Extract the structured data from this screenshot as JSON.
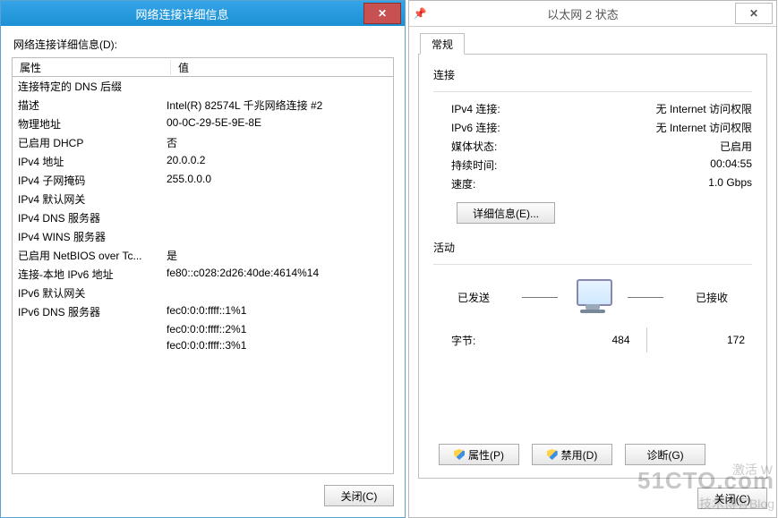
{
  "left": {
    "title": "网络连接详细信息",
    "listLabel": "网络连接详细信息(D):",
    "header": {
      "col1": "属性",
      "col2": "值"
    },
    "rows": [
      {
        "p": "连接特定的 DNS 后缀",
        "v": ""
      },
      {
        "p": "描述",
        "v": "Intel(R) 82574L 千兆网络连接 #2"
      },
      {
        "p": "物理地址",
        "v": "00-0C-29-5E-9E-8E"
      },
      {
        "p": "已启用 DHCP",
        "v": "否"
      },
      {
        "p": "IPv4 地址",
        "v": "20.0.0.2"
      },
      {
        "p": "IPv4 子网掩码",
        "v": "255.0.0.0"
      },
      {
        "p": "IPv4 默认网关",
        "v": ""
      },
      {
        "p": "IPv4 DNS 服务器",
        "v": ""
      },
      {
        "p": "IPv4 WINS 服务器",
        "v": ""
      },
      {
        "p": "已启用 NetBIOS over Tc...",
        "v": "是"
      },
      {
        "p": "连接-本地 IPv6 地址",
        "v": "fe80::c028:2d26:40de:4614%14"
      },
      {
        "p": "IPv6 默认网关",
        "v": ""
      },
      {
        "p": "IPv6 DNS 服务器",
        "v": "fec0:0:0:ffff::1%1"
      },
      {
        "p": "",
        "v": "fec0:0:0:ffff::2%1"
      },
      {
        "p": "",
        "v": "fec0:0:0:ffff::3%1"
      }
    ],
    "closeBtn": "关闭(C)"
  },
  "right": {
    "title": "以太网 2 状态",
    "tab": "常规",
    "conn": {
      "title": "连接",
      "rows": [
        {
          "k": "IPv4 连接:",
          "v": "无 Internet 访问权限"
        },
        {
          "k": "IPv6 连接:",
          "v": "无 Internet 访问权限"
        },
        {
          "k": "媒体状态:",
          "v": "已启用"
        },
        {
          "k": "持续时间:",
          "v": "00:04:55"
        },
        {
          "k": "速度:",
          "v": "1.0 Gbps"
        }
      ],
      "detailsBtn": "详细信息(E)..."
    },
    "activity": {
      "title": "活动",
      "sent": "已发送",
      "recv": "已接收",
      "bytesLabel": "字节:",
      "sentBytes": "484",
      "recvBytes": "172"
    },
    "buttons": {
      "props": "属性(P)",
      "disable": "禁用(D)",
      "diag": "诊断(G)"
    },
    "closeBtn": "关闭(C)"
  },
  "watermark": {
    "line1": "51CTO.com",
    "line2": "技术博客Blog"
  },
  "activateHint": "激活 W"
}
